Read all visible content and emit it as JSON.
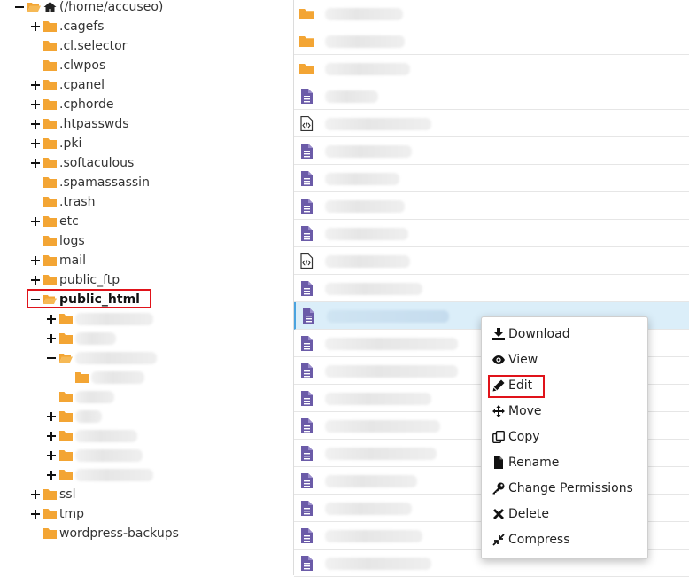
{
  "tree": {
    "root_label": "(/home/accuseo)",
    "items": [
      {
        "label": ".cagefs",
        "expandable": true
      },
      {
        "label": ".cl.selector",
        "expandable": false
      },
      {
        "label": ".clwpos",
        "expandable": false
      },
      {
        "label": ".cpanel",
        "expandable": true
      },
      {
        "label": ".cphorde",
        "expandable": true
      },
      {
        "label": ".htpasswds",
        "expandable": true
      },
      {
        "label": ".pki",
        "expandable": true
      },
      {
        "label": ".softaculous",
        "expandable": true
      },
      {
        "label": ".spamassassin",
        "expandable": false
      },
      {
        "label": ".trash",
        "expandable": false
      },
      {
        "label": "etc",
        "expandable": true
      },
      {
        "label": "logs",
        "expandable": false
      },
      {
        "label": "mail",
        "expandable": true
      },
      {
        "label": "public_ftp",
        "expandable": true
      },
      {
        "label": "public_html",
        "expandable": true,
        "expanded": true
      },
      {
        "label": "ssl",
        "expandable": true
      },
      {
        "label": "tmp",
        "expandable": true
      },
      {
        "label": "wordpress-backups",
        "expandable": false
      }
    ]
  },
  "context_menu": {
    "items": [
      {
        "label": "Download",
        "icon": "download-icon"
      },
      {
        "label": "View",
        "icon": "eye-icon"
      },
      {
        "label": "Edit",
        "icon": "pencil-icon"
      },
      {
        "label": "Move",
        "icon": "move-arrows-icon"
      },
      {
        "label": "Copy",
        "icon": "copy-icon"
      },
      {
        "label": "Rename",
        "icon": "file-icon"
      },
      {
        "label": "Change Permissions",
        "icon": "key-icon"
      },
      {
        "label": "Delete",
        "icon": "x-icon"
      },
      {
        "label": "Compress",
        "icon": "compress-icon"
      }
    ]
  },
  "colors": {
    "folder": "#f3a534",
    "file_icon": "#6b5ba8",
    "highlight_border": "#e0131a",
    "selected_row": "#dbeef9"
  }
}
